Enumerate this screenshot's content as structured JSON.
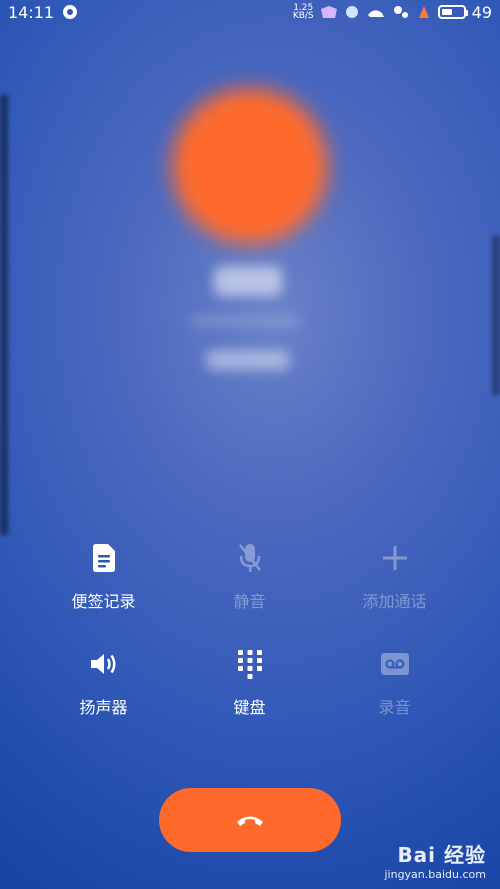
{
  "status_bar": {
    "time": "14:11",
    "net_speed_value": "1.25",
    "net_speed_unit": "KB/S",
    "battery": "49"
  },
  "call_controls": [
    {
      "name": "notes",
      "label": "便签记录",
      "icon": "note-icon",
      "enabled": true
    },
    {
      "name": "mute",
      "label": "静音",
      "icon": "mic-off-icon",
      "enabled": false
    },
    {
      "name": "add-call",
      "label": "添加通话",
      "icon": "plus-icon",
      "enabled": false
    },
    {
      "name": "speaker",
      "label": "扬声器",
      "icon": "speaker-icon",
      "enabled": true
    },
    {
      "name": "keypad",
      "label": "键盘",
      "icon": "keypad-icon",
      "enabled": true
    },
    {
      "name": "record",
      "label": "录音",
      "icon": "voicemail-icon",
      "enabled": false
    }
  ],
  "end_call": {
    "icon": "hang-up-icon",
    "color": "#ff6a2c"
  },
  "watermark": {
    "brand": "Bai 经验",
    "url": "jingyan.baidu.com"
  },
  "colors": {
    "accent": "#ff6a2c",
    "background": "#2e57b6"
  }
}
